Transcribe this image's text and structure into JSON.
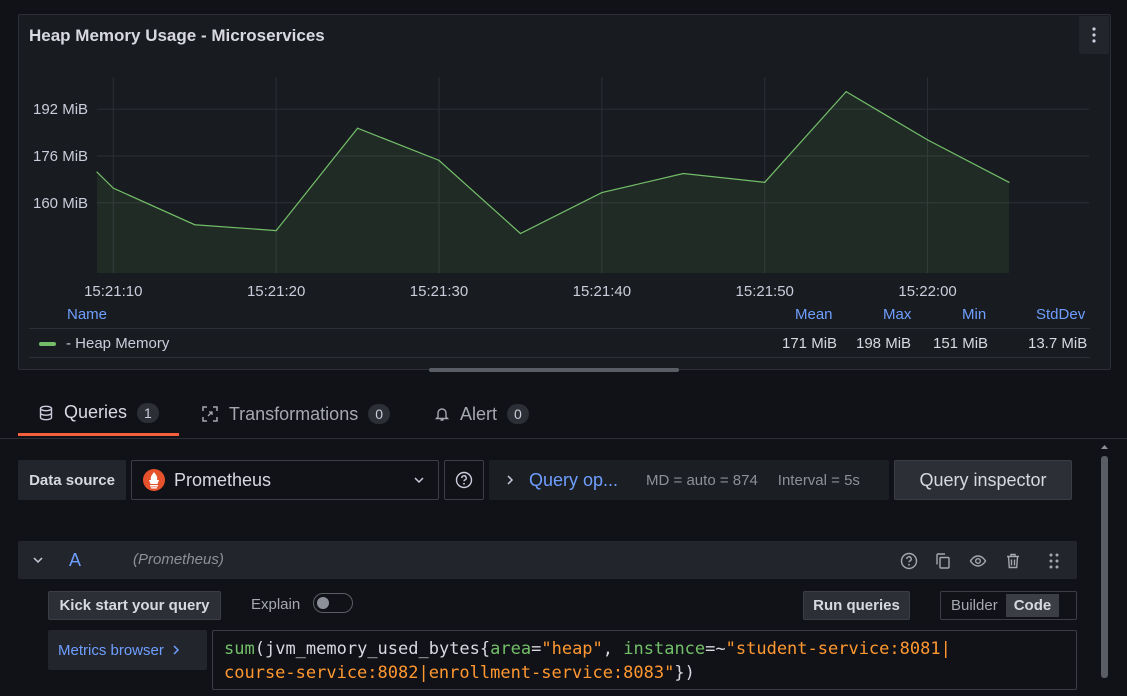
{
  "panel": {
    "title": "Heap Memory Usage - Microservices",
    "menu_icon": "kebab-vertical-icon"
  },
  "chart_data": {
    "type": "area",
    "x": [
      "15:21:09",
      "15:21:10",
      "15:21:15",
      "15:21:20",
      "15:21:25",
      "15:21:30",
      "15:21:35",
      "15:21:40",
      "15:21:45",
      "15:21:50",
      "15:21:55",
      "15:22:00",
      "15:22:05"
    ],
    "series": [
      {
        "name": "- Heap Memory",
        "color": "#73bf69",
        "values": [
          170.5,
          165,
          152.5,
          150.5,
          185.5,
          174.5,
          149.5,
          163.5,
          170,
          167,
          198,
          181.5,
          167
        ]
      }
    ],
    "y_ticks": [
      "160 MiB",
      "176 MiB",
      "192 MiB"
    ],
    "x_ticks": [
      "15:21:10",
      "15:21:20",
      "15:21:30",
      "15:21:40",
      "15:21:50",
      "15:22:00"
    ],
    "ylim": [
      136,
      203
    ],
    "grid": true
  },
  "legend": {
    "headers": {
      "name": "Name",
      "mean": "Mean",
      "max": "Max",
      "min": "Min",
      "stddev": "StdDev"
    },
    "row": {
      "name": "- Heap Memory",
      "mean": "171 MiB",
      "max": "198 MiB",
      "min": "151 MiB",
      "stddev": "13.7 MiB",
      "color": "#73bf69"
    }
  },
  "tabs": [
    {
      "label": "Queries",
      "count": "1",
      "icon": "database-icon",
      "active": true
    },
    {
      "label": "Transformations",
      "count": "0",
      "icon": "transform-icon",
      "active": false
    },
    {
      "label": "Alert",
      "count": "0",
      "icon": "bell-icon",
      "active": false
    }
  ],
  "toolbar": {
    "datasource_label": "Data source",
    "datasource_value": "Prometheus",
    "query_options_label": "Query op...",
    "md": "MD = auto = 874",
    "interval": "Interval = 5s",
    "inspector_label": "Query inspector"
  },
  "query": {
    "letter": "A",
    "datasource": "(Prometheus)",
    "kick_start": "Kick start your query",
    "explain": "Explain",
    "run": "Run queries",
    "builder": "Builder",
    "code": "Code",
    "metrics_browser": "Metrics browser",
    "expr": {
      "fn": "sum",
      "metric": "jvm_memory_used_bytes",
      "label1": "area",
      "val1": "\"heap\"",
      "label2": "instance",
      "op2": "=~",
      "val2_line1": "\"student-service:8081|",
      "val2_line2": "course-service:8082|enrollment-service:8083\""
    }
  }
}
